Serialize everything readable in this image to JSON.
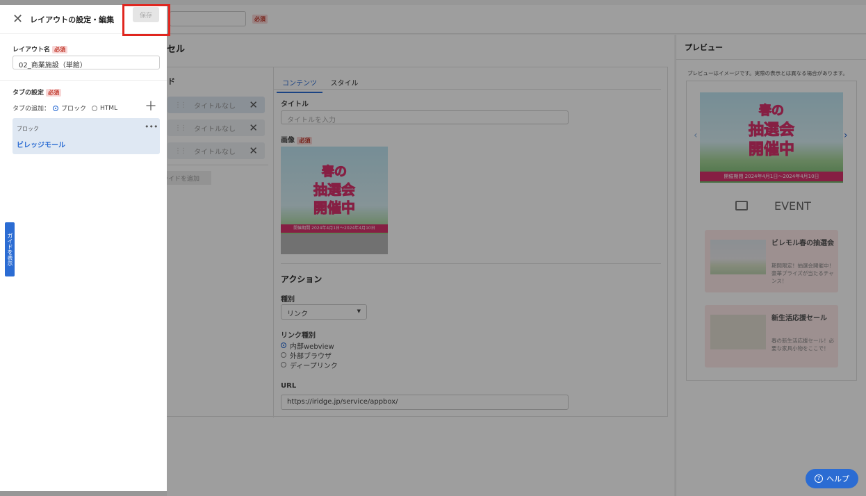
{
  "required_badge": "必須",
  "background": {
    "editor_title_fragment": "セル",
    "slides_title_fragment": "ド",
    "slides": [
      {
        "label": "タイトルなし"
      },
      {
        "label": "タイトルなし"
      },
      {
        "label": "タイトルなし"
      }
    ],
    "add_slide_label": "ライドを追加",
    "tabs": {
      "content": "コンテンツ",
      "style": "スタイル"
    },
    "title_label": "タイトル",
    "title_placeholder": "タイトルを入力",
    "image_label": "画像",
    "action_heading": "アクション",
    "type_label": "種別",
    "type_value": "リンク",
    "link_type_label": "リンク種別",
    "link_options": [
      "内部webview",
      "外部ブラウザ",
      "ディープリンク"
    ],
    "link_selected_index": 0,
    "url_label": "URL",
    "url_value": "https://iridge.jp/service/appbox/",
    "banner": {
      "line1": "春の",
      "line2": "抽選会",
      "line3": "開催中",
      "period": "開催期間 2024年4月1日～2024年4月10日"
    },
    "preview": {
      "title": "プレビュー",
      "note": "プレビューはイメージです。実際の表示とは異なる場合があります。",
      "event_label": "EVENT",
      "cards": [
        {
          "title": "ビレモル春の抽選会",
          "desc": "期間限定！抽選会開催中！豪華プライズが当たるチャンス！"
        },
        {
          "title": "新生活応援セール",
          "desc": "春の新生活応援セール！必要な家具小物をここで！"
        }
      ]
    }
  },
  "left_panel": {
    "title": "レイアウトの設定・編集",
    "save_label": "保存",
    "layout_name_label": "レイアウト名",
    "layout_name_value": "02_商業施設（単館）",
    "tab_settings_label": "タブの設定",
    "tab_add_label": "タブの追加：",
    "tab_add_options": [
      "ブロック",
      "HTML"
    ],
    "tab_add_selected": "ブロック",
    "block_item": {
      "label": "ブロック",
      "name": "ビレッジモール"
    },
    "guide_label": "ガイドを表示"
  },
  "help_label": "ヘルプ",
  "colors": {
    "accent": "#2b6cd3",
    "required": "#c0392b",
    "highlight": "#e0261f"
  }
}
